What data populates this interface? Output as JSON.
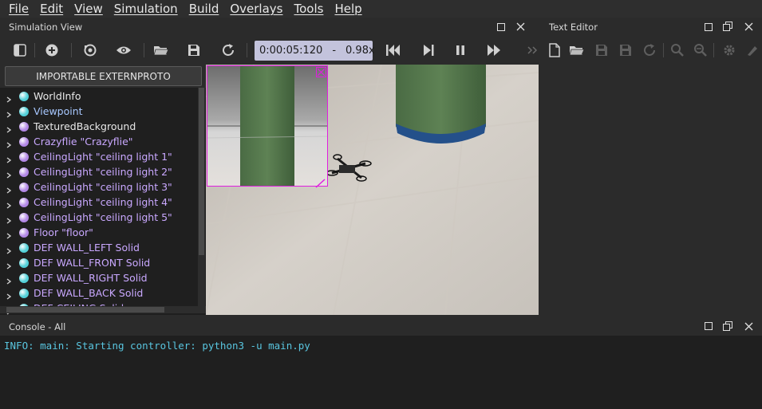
{
  "menu": [
    "File",
    "Edit",
    "View",
    "Simulation",
    "Build",
    "Overlays",
    "Tools",
    "Help"
  ],
  "simulation_view": {
    "title": "Simulation View"
  },
  "text_editor": {
    "title": "Text Editor"
  },
  "time": {
    "elapsed": "0:00:05:120",
    "separator": "-",
    "speed": "0.98x"
  },
  "import_button": "IMPORTABLE EXTERNPROTO",
  "scene_tree": [
    {
      "label": "WorldInfo",
      "color": "#52d0d8",
      "text_color": "#e8e8e8"
    },
    {
      "label": "Viewpoint",
      "color": "#52d0d8",
      "text_color": "#a8c8ff"
    },
    {
      "label": "TexturedBackground",
      "color": "#b287e6",
      "text_color": "#e8e8e8"
    },
    {
      "label": "Crazyflie \"Crazyflie\"",
      "color": "#b287e6",
      "text_color": "#c9a8ff"
    },
    {
      "label": "CeilingLight \"ceiling light 1\"",
      "color": "#b287e6",
      "text_color": "#c9a8ff"
    },
    {
      "label": "CeilingLight \"ceiling light 2\"",
      "color": "#b287e6",
      "text_color": "#c9a8ff"
    },
    {
      "label": "CeilingLight \"ceiling light 3\"",
      "color": "#b287e6",
      "text_color": "#c9a8ff"
    },
    {
      "label": "CeilingLight \"ceiling light 4\"",
      "color": "#b287e6",
      "text_color": "#c9a8ff"
    },
    {
      "label": "CeilingLight \"ceiling light 5\"",
      "color": "#b287e6",
      "text_color": "#c9a8ff"
    },
    {
      "label": "Floor \"floor\"",
      "color": "#b287e6",
      "text_color": "#c9a8ff"
    },
    {
      "label": "DEF WALL_LEFT Solid",
      "color": "#52d0d8",
      "text_color": "#c9a8ff"
    },
    {
      "label": "DEF WALL_FRONT Solid",
      "color": "#52d0d8",
      "text_color": "#c9a8ff"
    },
    {
      "label": "DEF WALL_RIGHT Solid",
      "color": "#52d0d8",
      "text_color": "#c9a8ff"
    },
    {
      "label": "DEF WALL_BACK Solid",
      "color": "#52d0d8",
      "text_color": "#c9a8ff"
    },
    {
      "label": "DEF CEILING Solid",
      "color": "#52d0d8",
      "text_color": "#c9a8ff"
    }
  ],
  "console": {
    "title": "Console - All",
    "lines": [
      "INFO: main: Starting controller: python3 -u main.py"
    ]
  },
  "colors": {
    "accent_time": "#c3c3dc",
    "overlay_magenta": "#e01ee0",
    "console_text": "#59c6e0"
  }
}
